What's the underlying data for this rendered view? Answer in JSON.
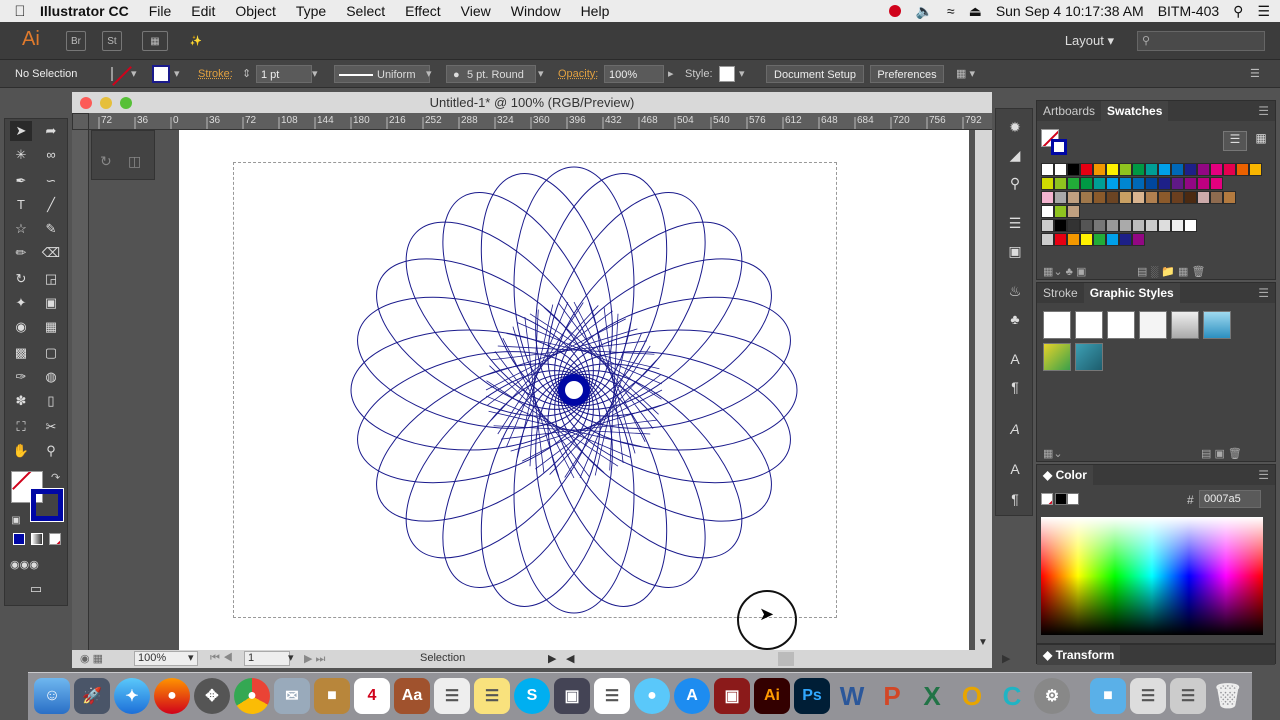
{
  "menubar": {
    "app_name": "Illustrator CC",
    "menus": [
      "File",
      "Edit",
      "Object",
      "Type",
      "Select",
      "Effect",
      "View",
      "Window",
      "Help"
    ],
    "clock": "Sun Sep 4  10:17:38 AM",
    "user": "BITM-403"
  },
  "appbar": {
    "logo": "Ai",
    "workspace": "Layout"
  },
  "controlbar": {
    "selection": "No Selection",
    "stroke_label": "Stroke:",
    "stroke_weight": "1 pt",
    "profile": "Uniform",
    "brush": "5 pt. Round",
    "opacity_label": "Opacity:",
    "opacity": "100%",
    "style_label": "Style:",
    "document_setup": "Document Setup",
    "preferences": "Preferences"
  },
  "document": {
    "title": "Untitled-1* @ 100% (RGB/Preview)",
    "ruler_ticks": [
      "72",
      "36",
      "0",
      "36",
      "72",
      "108",
      "144",
      "180",
      "216",
      "252",
      "288",
      "324",
      "360",
      "396",
      "432",
      "468",
      "504",
      "540",
      "576",
      "612",
      "648",
      "684",
      "720",
      "756",
      "792"
    ],
    "zoom": "100%",
    "artboard_num": "1",
    "status": "Selection"
  },
  "panels": {
    "swatches_tabs": [
      "Artboards",
      "Swatches"
    ],
    "graphic_styles_tabs": [
      "Stroke",
      "Graphic Styles"
    ],
    "color_tab": "Color",
    "color_hex_label": "#",
    "color_hex": "0007a5",
    "transform_tab": "Transform"
  },
  "colors": {
    "spiro_stroke": "#1a1a8c",
    "center_fill": "#0007a5"
  }
}
